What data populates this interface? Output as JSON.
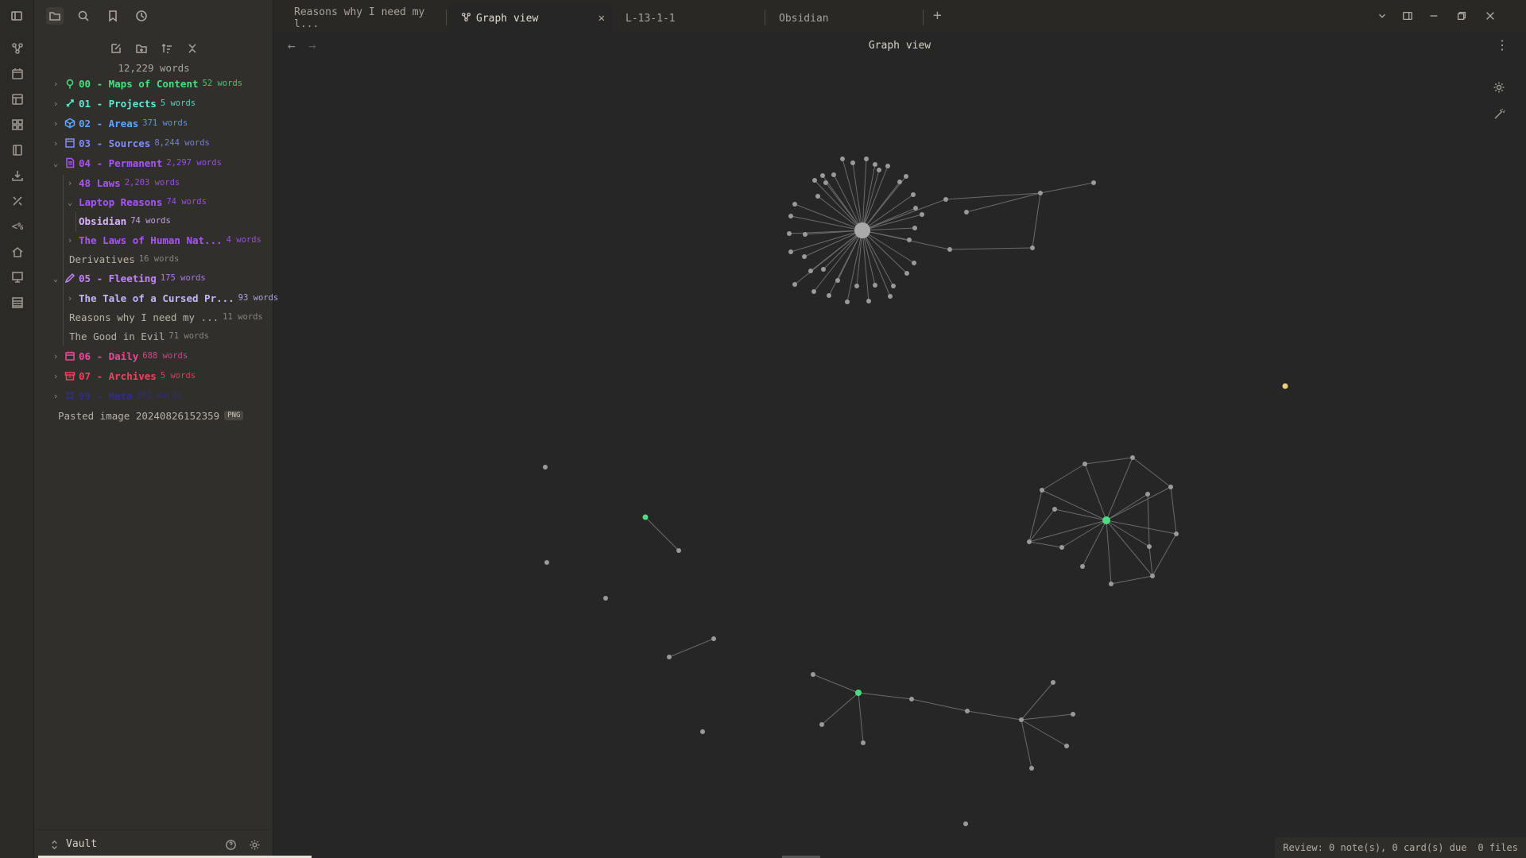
{
  "app": {
    "accent": "#4ade80",
    "background": "#262626"
  },
  "sidebar": {
    "word_count": "12,229 words",
    "items": [
      {
        "label": "00 - Maps of Content",
        "words": "52 words",
        "color": "#4ade80",
        "icon": "map-pin-icon"
      },
      {
        "label": "01 - Projects",
        "words": "5 words",
        "color": "#5eead4",
        "icon": "rocket-icon"
      },
      {
        "label": "02 - Areas",
        "words": "371 words",
        "color": "#60a5fa",
        "icon": "cube-icon"
      },
      {
        "label": "03 - Sources",
        "words": "8,244 words",
        "color": "#818cf8",
        "icon": "book-icon"
      },
      {
        "label": "04 - Permanent",
        "words": "2,297 words",
        "color": "#a855f7",
        "icon": "document-icon"
      },
      {
        "label": "48 Laws",
        "words": "2,203 words",
        "color": "#a855f7"
      },
      {
        "label": "Laptop Reasons",
        "words": "74 words",
        "color": "#a855f7"
      },
      {
        "label": "Obsidian",
        "words": "74 words",
        "color": "#d8b4fe"
      },
      {
        "label": "The Laws of Human Nat...",
        "words": "4 words",
        "color": "#a855f7"
      },
      {
        "label": "Derivatives",
        "words": "16 words"
      },
      {
        "label": "05 - Fleeting",
        "words": "175 words",
        "color": "#c084fc",
        "icon": "pencil-icon"
      },
      {
        "label": "The Tale of a Cursed Pr...",
        "words": "93 words",
        "color": "#c4b5fd"
      },
      {
        "label": "Reasons why I need my ...",
        "words": "11 words"
      },
      {
        "label": "The Good in Evil",
        "words": "71 words"
      },
      {
        "label": "06 - Daily",
        "words": "688 words",
        "color": "#ec4899",
        "icon": "calendar-icon"
      },
      {
        "label": "07 - Archives",
        "words": "5 words",
        "color": "#f43f5e",
        "icon": "archive-icon"
      },
      {
        "label": "99 - Meta",
        "words": "392 words",
        "color": "#312e81",
        "icon": "frame-icon"
      },
      {
        "label": "Pasted image 20240826152359",
        "badge": "PNG"
      }
    ],
    "vault": "Vault"
  },
  "tabs": [
    {
      "label": "Reasons why I need my l..."
    },
    {
      "label": "Graph view",
      "active": true
    },
    {
      "label": "L-13-1-1"
    },
    {
      "label": "Obsidian"
    }
  ],
  "view": {
    "title": "Graph view"
  },
  "status": {
    "review": "Review: 0 note(s), 0 card(s) due",
    "files": "0 files"
  },
  "graph": {
    "edge_color": "#6b6b6b",
    "node_color": "#9a9a9a",
    "highlight_color": "#4ade80",
    "attachment_color": "#e8d27a"
  }
}
